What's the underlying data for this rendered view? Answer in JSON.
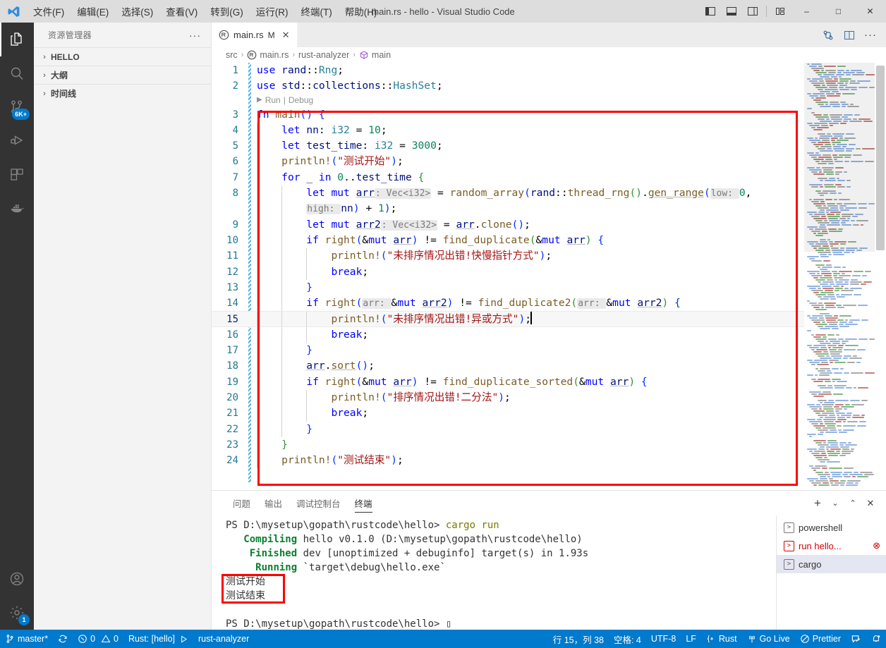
{
  "titlebar": {
    "logo_icon": "vscode-logo-icon",
    "menus": [
      {
        "label": "文件(F)",
        "mnemonic": "F"
      },
      {
        "label": "编辑(E)",
        "mnemonic": "E"
      },
      {
        "label": "选择(S)",
        "mnemonic": "S"
      },
      {
        "label": "查看(V)",
        "mnemonic": "V"
      },
      {
        "label": "转到(G)",
        "mnemonic": "G"
      },
      {
        "label": "运行(R)",
        "mnemonic": "R"
      },
      {
        "label": "终端(T)",
        "mnemonic": "T"
      },
      {
        "label": "帮助(H)",
        "mnemonic": "H"
      }
    ],
    "window_title": "main.rs - hello - Visual Studio Code",
    "layout_buttons": [
      "toggle-primary-sidebar-icon",
      "toggle-panel-icon",
      "toggle-secondary-sidebar-icon",
      "customize-layout-icon"
    ],
    "minimize": "–",
    "maximize": "□",
    "close": "✕"
  },
  "activitybar": {
    "items": [
      {
        "name": "explorer",
        "icon": "files-icon",
        "active": true,
        "badge": ""
      },
      {
        "name": "search",
        "icon": "search-icon",
        "active": false,
        "badge": ""
      },
      {
        "name": "source-control",
        "icon": "source-control-icon",
        "active": false,
        "badge": "6K+"
      },
      {
        "name": "run-and-debug",
        "icon": "run-debug-icon",
        "active": false,
        "badge": ""
      },
      {
        "name": "extensions",
        "icon": "extensions-icon",
        "active": false,
        "badge": ""
      },
      {
        "name": "docker",
        "icon": "docker-icon",
        "active": false,
        "badge": ""
      }
    ],
    "bottom": [
      {
        "name": "accounts",
        "icon": "account-icon",
        "badge": ""
      },
      {
        "name": "manage",
        "icon": "gear-icon",
        "badge": "1"
      }
    ]
  },
  "sidebar": {
    "title": "资源管理器",
    "more_actions": "···",
    "sections": [
      {
        "label": "HELLO",
        "expanded": false,
        "chevron": "›"
      },
      {
        "label": "大纲",
        "expanded": false,
        "chevron": "›"
      },
      {
        "label": "时间线",
        "expanded": false,
        "chevron": "›"
      }
    ]
  },
  "editor": {
    "tab": {
      "label": "main.rs",
      "icon": "rust-file-icon",
      "dirty_badge": "M",
      "close": "✕"
    },
    "tab_actions": [
      "split-toggle-icon",
      "split-editor-icon",
      "more-actions-icon"
    ],
    "breadcrumb": [
      {
        "label": "src",
        "icon": ""
      },
      {
        "label": "main.rs",
        "icon": "rust-file-icon"
      },
      {
        "label": "rust-analyzer",
        "icon": ""
      },
      {
        "label": "main",
        "icon": "symbol-method-icon"
      }
    ],
    "breadcrumb_separator": "›",
    "codelens": {
      "run": "Run",
      "sep": "|",
      "debug": "Debug"
    },
    "cursor_line": 15,
    "lines": [
      {
        "n": "1",
        "indent": 0,
        "html": "<span class='kw'>use</span> <span class='var'>rand</span><span class='pun'>::</span><span class='typ'>Rng</span><span class='pun'>;</span>"
      },
      {
        "n": "2",
        "indent": 0,
        "html": "<span class='kw'>use</span> <span class='var'>std</span><span class='pun'>::</span><span class='var'>collections</span><span class='pun'>::</span><span class='typ'>HashSet</span><span class='pun'>;</span>"
      },
      {
        "n": "3",
        "indent": 0,
        "html": "<span class='kw'>fn</span> <span class='fn'>main</span><span class='brkt'>()</span> <span class='brkt'>{</span>"
      },
      {
        "n": "4",
        "indent": 1,
        "html": "    <span class='kw'>let</span> <span class='var'>nn</span><span class='pun'>:</span> <span class='typ'>i32</span> <span class='op'>=</span> <span class='num'>10</span><span class='pun'>;</span>"
      },
      {
        "n": "5",
        "indent": 1,
        "html": "    <span class='kw'>let</span> <span class='var'>test_time</span><span class='pun'>:</span> <span class='typ'>i32</span> <span class='op'>=</span> <span class='num'>3000</span><span class='pun'>;</span>"
      },
      {
        "n": "6",
        "indent": 1,
        "html": "    <span class='mac'>println!</span><span class='brkt'>(</span><span class='str'>\"测试开始\"</span><span class='brkt'>)</span><span class='pun'>;</span>"
      },
      {
        "n": "7",
        "indent": 1,
        "html": "    <span class='kw'>for</span> <span class='var'>_</span> <span class='kw'>in</span> <span class='num'>0</span><span class='pun'>..</span><span class='var'>test_time</span> <span class='brkt2'>{</span>"
      },
      {
        "n": "8",
        "indent": 2,
        "html": "        <span class='kw'>let</span> <span class='kw'>mut</span> <span class='var ul'>arr</span><span class='hint'>: Vec&lt;i32&gt;</span> <span class='op'>=</span> <span class='fn'>random_array</span><span class='brkt'>(</span><span class='var'>rand</span><span class='pun'>::</span><span class='fn'>thread_rng</span><span class='brkt2'>()</span><span class='pun'>.</span><span class='fn ul'>gen_range</span><span class='brkt'>(</span><span class='hint'>low: </span><span class='num'>0</span><span class='pun'>,</span>"
      },
      {
        "n": "",
        "indent": 2,
        "html": "        <span class='hint'>high: </span><span class='var'>nn</span><span class='brkt'>)</span> <span class='op'>+</span> <span class='num'>1</span><span class='brkt'>)</span><span class='pun'>;</span>"
      },
      {
        "n": "9",
        "indent": 2,
        "html": "        <span class='kw'>let</span> <span class='kw'>mut</span> <span class='var ul'>arr2</span><span class='hint'>: Vec&lt;i32&gt;</span> <span class='op'>=</span> <span class='var ul'>arr</span><span class='pun'>.</span><span class='fn'>clone</span><span class='brkt'>()</span><span class='pun'>;</span>"
      },
      {
        "n": "10",
        "indent": 2,
        "html": "        <span class='kw'>if</span> <span class='fn'>right</span><span class='brkt'>(</span><span class='op'>&amp;</span><span class='kw'>mut</span> <span class='var ul'>arr</span><span class='brkt'>)</span> <span class='op'>!=</span> <span class='fn'>find_duplicate</span><span class='brkt2'>(</span><span class='op'>&amp;</span><span class='kw'>mut</span> <span class='var ul'>arr</span><span class='brkt2'>)</span> <span class='brkt'>{</span>"
      },
      {
        "n": "11",
        "indent": 3,
        "html": "            <span class='mac'>println!</span><span class='brkt'>(</span><span class='str'>\"未排序情况出错!快慢指针方式\"</span><span class='brkt'>)</span><span class='pun'>;</span>"
      },
      {
        "n": "12",
        "indent": 3,
        "html": "            <span class='kw'>break</span><span class='pun'>;</span>"
      },
      {
        "n": "13",
        "indent": 2,
        "html": "        <span class='brkt'>}</span>"
      },
      {
        "n": "14",
        "indent": 2,
        "html": "        <span class='kw'>if</span> <span class='fn'>right</span><span class='brkt'>(</span><span class='hint'>arr: </span><span class='op'>&amp;</span><span class='kw'>mut</span> <span class='var ul'>arr2</span><span class='brkt'>)</span> <span class='op'>!=</span> <span class='fn'>find_duplicate2</span><span class='brkt2'>(</span><span class='hint'>arr: </span><span class='op'>&amp;</span><span class='kw'>mut</span> <span class='var ul'>arr2</span><span class='brkt2'>)</span> <span class='brkt'>{</span>"
      },
      {
        "n": "15",
        "indent": 3,
        "cur": true,
        "html": "            <span class='mac'>println!</span><span class='brkt'>(</span><span class='str'>\"未排序情况出错!异或方式\"</span><span class='brkt'>)</span><span class='pun'>;</span><span class='cursor'></span>"
      },
      {
        "n": "16",
        "indent": 3,
        "html": "            <span class='kw'>break</span><span class='pun'>;</span>"
      },
      {
        "n": "17",
        "indent": 2,
        "html": "        <span class='brkt'>}</span>"
      },
      {
        "n": "18",
        "indent": 2,
        "html": "        <span class='var ul'>arr</span><span class='pun'>.</span><span class='fn ul'>sort</span><span class='brkt'>()</span><span class='pun'>;</span>"
      },
      {
        "n": "19",
        "indent": 2,
        "html": "        <span class='kw'>if</span> <span class='fn'>right</span><span class='brkt'>(</span><span class='op'>&amp;</span><span class='kw'>mut</span> <span class='var ul'>arr</span><span class='brkt'>)</span> <span class='op'>!=</span> <span class='fn'>find_duplicate_sorted</span><span class='brkt2'>(</span><span class='op'>&amp;</span><span class='kw'>mut</span> <span class='var ul'>arr</span><span class='brkt2'>)</span> <span class='brkt'>{</span>"
      },
      {
        "n": "20",
        "indent": 3,
        "html": "            <span class='mac'>println!</span><span class='brkt'>(</span><span class='str'>\"排序情况出错!二分法\"</span><span class='brkt'>)</span><span class='pun'>;</span>"
      },
      {
        "n": "21",
        "indent": 3,
        "html": "            <span class='kw'>break</span><span class='pun'>;</span>"
      },
      {
        "n": "22",
        "indent": 2,
        "html": "        <span class='brkt'>}</span>"
      },
      {
        "n": "23",
        "indent": 1,
        "html": "    <span class='brkt2'>}</span>"
      },
      {
        "n": "24",
        "indent": 1,
        "html": "    <span class='mac'>println!</span><span class='brkt'>(</span><span class='str'>\"测试结束\"</span><span class='brkt'>)</span><span class='pun'>;</span>"
      }
    ]
  },
  "panel": {
    "tabs": [
      {
        "label": "问题",
        "active": false
      },
      {
        "label": "输出",
        "active": false
      },
      {
        "label": "调试控制台",
        "active": false
      },
      {
        "label": "终端",
        "active": true
      }
    ],
    "actions": [
      {
        "name": "new-terminal",
        "glyph": "+"
      },
      {
        "name": "terminal-dropdown",
        "glyph": "⌄"
      },
      {
        "name": "maximize-panel",
        "glyph": "⌃"
      },
      {
        "name": "close-panel",
        "glyph": "✕"
      }
    ],
    "terminal_lines": [
      {
        "parts": [
          {
            "t": "PS D:\\mysetup\\gopath\\rustcode\\hello> ",
            "c": ""
          },
          {
            "t": "cargo run",
            "c": "t-yellow"
          }
        ]
      },
      {
        "parts": [
          {
            "t": "   ",
            "c": ""
          },
          {
            "t": "Compiling",
            "c": "t-green"
          },
          {
            "t": " hello v0.1.0 (D:\\mysetup\\gopath\\rustcode\\hello)",
            "c": ""
          }
        ]
      },
      {
        "parts": [
          {
            "t": "    ",
            "c": ""
          },
          {
            "t": "Finished",
            "c": "t-green"
          },
          {
            "t": " dev [unoptimized + debuginfo] target(s) in 1.93s",
            "c": ""
          }
        ]
      },
      {
        "parts": [
          {
            "t": "     ",
            "c": ""
          },
          {
            "t": "Running",
            "c": "t-green"
          },
          {
            "t": " `target\\debug\\hello.exe`",
            "c": ""
          }
        ]
      },
      {
        "parts": [
          {
            "t": "测试开始",
            "c": ""
          }
        ]
      },
      {
        "parts": [
          {
            "t": "测试结束",
            "c": ""
          }
        ]
      },
      {
        "parts": [
          {
            "t": "",
            "c": ""
          }
        ]
      },
      {
        "parts": [
          {
            "t": "PS D:\\mysetup\\gopath\\rustcode\\hello> ▯",
            "c": ""
          }
        ]
      }
    ],
    "terminal_instances": [
      {
        "label": "powershell",
        "active": false,
        "error": false,
        "kill": ""
      },
      {
        "label": "run hello...",
        "active": false,
        "error": true,
        "kill": "⊗"
      },
      {
        "label": "cargo",
        "active": true,
        "error": false,
        "kill": ""
      }
    ]
  },
  "statusbar": {
    "left": [
      {
        "name": "remote-branch",
        "icon": "git-branch-icon",
        "label": "master*"
      },
      {
        "name": "sync-changes",
        "icon": "sync-icon",
        "label": ""
      },
      {
        "name": "problems",
        "icon": "error-warning-icon",
        "label": "0  0",
        "errors": "0",
        "warnings": "0"
      },
      {
        "name": "rust-project",
        "icon": "",
        "label": "Rust: [hello]"
      },
      {
        "name": "rust-run",
        "icon": "play-icon",
        "label": ""
      },
      {
        "name": "rust-analyzer-status",
        "icon": "",
        "label": "rust-analyzer"
      }
    ],
    "right": [
      {
        "name": "cursor-position",
        "icon": "",
        "label": "行 15，列 38"
      },
      {
        "name": "indentation",
        "icon": "",
        "label": "空格: 4"
      },
      {
        "name": "encoding",
        "icon": "",
        "label": "UTF-8"
      },
      {
        "name": "eol",
        "icon": "",
        "label": "LF"
      },
      {
        "name": "language-mode",
        "icon": "rust-lang-icon",
        "label": "Rust"
      },
      {
        "name": "go-live",
        "icon": "broadcast-icon",
        "label": "Go Live"
      },
      {
        "name": "prettier",
        "icon": "prettier-icon",
        "label": "Prettier"
      },
      {
        "name": "feedback",
        "icon": "feedback-icon",
        "label": ""
      },
      {
        "name": "notifications",
        "icon": "bell-icon",
        "label": ""
      }
    ]
  },
  "annotations": {
    "code_box_color": "#ff0000",
    "terminal_box_color": "#ff0000"
  },
  "colors": {
    "accent": "#007acc",
    "titlebar_bg": "#dddddd",
    "activitybar_bg": "#333333",
    "sidebar_bg": "#f3f3f3",
    "editor_bg": "#ffffff"
  }
}
